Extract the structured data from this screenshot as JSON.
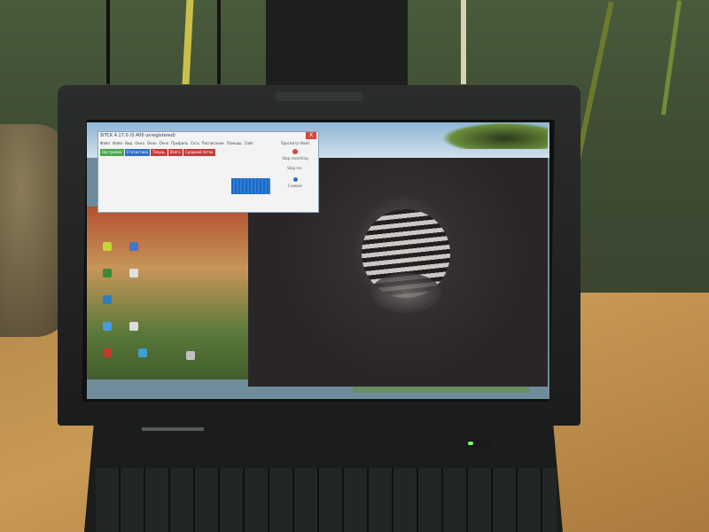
{
  "app": {
    "title": "SITCK 4.17.0 (0.400 unregistered)",
    "close_label": "X",
    "menu": [
      "Файл",
      "Файл",
      "Вид",
      "Окна",
      "Окно",
      "Окно",
      "Профиль",
      "Сеть",
      "Расписание",
      "Помощь",
      "Сайт"
    ],
    "tabs": [
      {
        "label": "Настройки",
        "color": "#4aa84a"
      },
      {
        "label": "Статистика",
        "color": "#2d6fc9"
      },
      {
        "label": "Текущ.",
        "color": "#c43c3c"
      },
      {
        "label": "Всего",
        "color": "#c43c3c"
      },
      {
        "label": "Средний поток",
        "color": "#c43c3c"
      }
    ],
    "right_panel": [
      "Просмотр Файл",
      "Stop recording",
      "Stop rec.",
      "Снимок"
    ]
  },
  "colors": {
    "window_border": "#8ba2b9",
    "graph_blue": "#1c67c2",
    "close_red": "#d9463a"
  }
}
